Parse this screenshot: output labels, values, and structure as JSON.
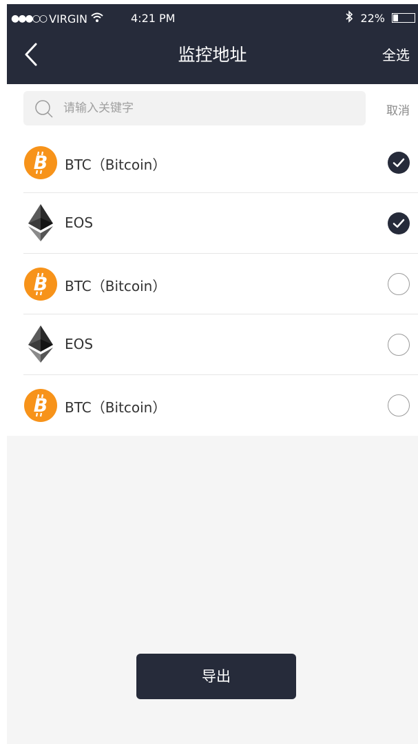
{
  "status_bar": {
    "signal": "●●●○○",
    "carrier": "VIRGIN",
    "wifi_icon": "wifi-icon",
    "time": "4:21 PM",
    "bluetooth_icon": "bluetooth-icon",
    "battery": "22%",
    "battery_level": 0.22
  },
  "nav": {
    "back_icon": "chevron-left-icon",
    "title": "监控地址",
    "select_all": "全选"
  },
  "search": {
    "placeholder": "请输入关键字",
    "value": "",
    "cancel": "取消"
  },
  "items": [
    {
      "name": "BTC（Bitcoin）",
      "icon": "bitcoin-icon",
      "checked": true
    },
    {
      "name": "EOS",
      "icon": "ethereum-icon",
      "checked": true
    },
    {
      "name": "BTC（Bitcoin）",
      "icon": "bitcoin-icon",
      "checked": false
    },
    {
      "name": "EOS",
      "icon": "ethereum-icon",
      "checked": false
    },
    {
      "name": "BTC（Bitcoin）",
      "icon": "bitcoin-icon",
      "checked": false
    }
  ],
  "export_label": "导出",
  "colors": {
    "header": "#262b3a",
    "bitcoin_orange": "#f7931a",
    "background": "#f5f5f5"
  }
}
